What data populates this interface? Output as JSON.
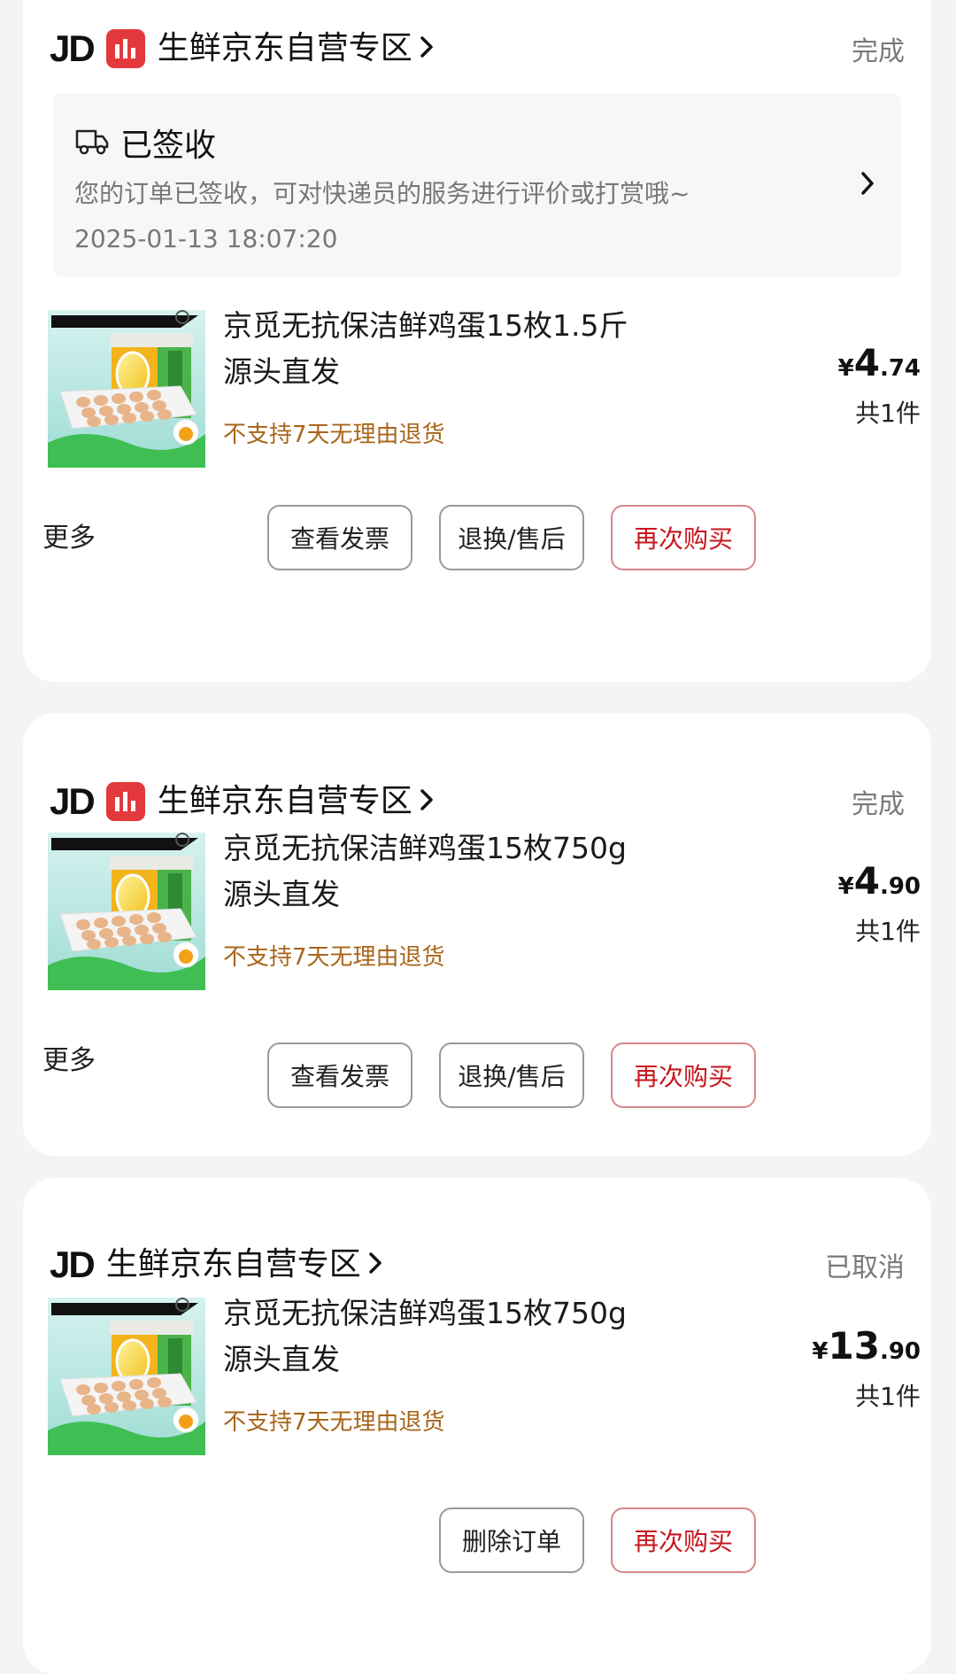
{
  "colors": {
    "accent_red": "#c8161d",
    "badge_red": "#e4393c",
    "return_note": "#a8651a",
    "status_gray": "#7a7a7a"
  },
  "orders": [
    {
      "store": {
        "logo": "JD",
        "fresh_badge_icon": "fresh-badge-icon",
        "name": "生鲜京东自营专区"
      },
      "status": "完成",
      "logistics": {
        "icon": "delivery-truck-icon",
        "title": "已签收",
        "message": "您的订单已签收，可对快递员的服务进行评价或打赏哦~",
        "time": "2025-01-13 18:07:20"
      },
      "product": {
        "image_icon": "egg-box-image",
        "title": "京觅无抗保洁鲜鸡蛋15枚1.5斤源头直发",
        "return_note": "不支持7天无理由退货",
        "price_symbol": "¥",
        "price_int": "4",
        "price_dec": ".74",
        "qty": "共1件"
      },
      "more": "更多",
      "buttons": [
        "查看发票",
        "退换/售后",
        "再次购买"
      ]
    },
    {
      "store": {
        "logo": "JD",
        "fresh_badge_icon": "fresh-badge-icon",
        "name": "生鲜京东自营专区"
      },
      "status": "完成",
      "product": {
        "image_icon": "egg-box-image",
        "title": "京觅无抗保洁鲜鸡蛋15枚750g 源头直发",
        "return_note": "不支持7天无理由退货",
        "price_symbol": "¥",
        "price_int": "4",
        "price_dec": ".90",
        "qty": "共1件"
      },
      "more": "更多",
      "buttons": [
        "查看发票",
        "退换/售后",
        "再次购买"
      ]
    },
    {
      "store": {
        "logo": "JD",
        "name": "生鲜京东自营专区"
      },
      "status": "已取消",
      "product": {
        "image_icon": "egg-box-image",
        "title": "京觅无抗保洁鲜鸡蛋15枚750g 源头直发",
        "return_note": "不支持7天无理由退货",
        "price_symbol": "¥",
        "price_int": "13",
        "price_dec": ".90",
        "qty": "共1件"
      },
      "buttons": [
        "删除订单",
        "再次购买"
      ]
    }
  ]
}
